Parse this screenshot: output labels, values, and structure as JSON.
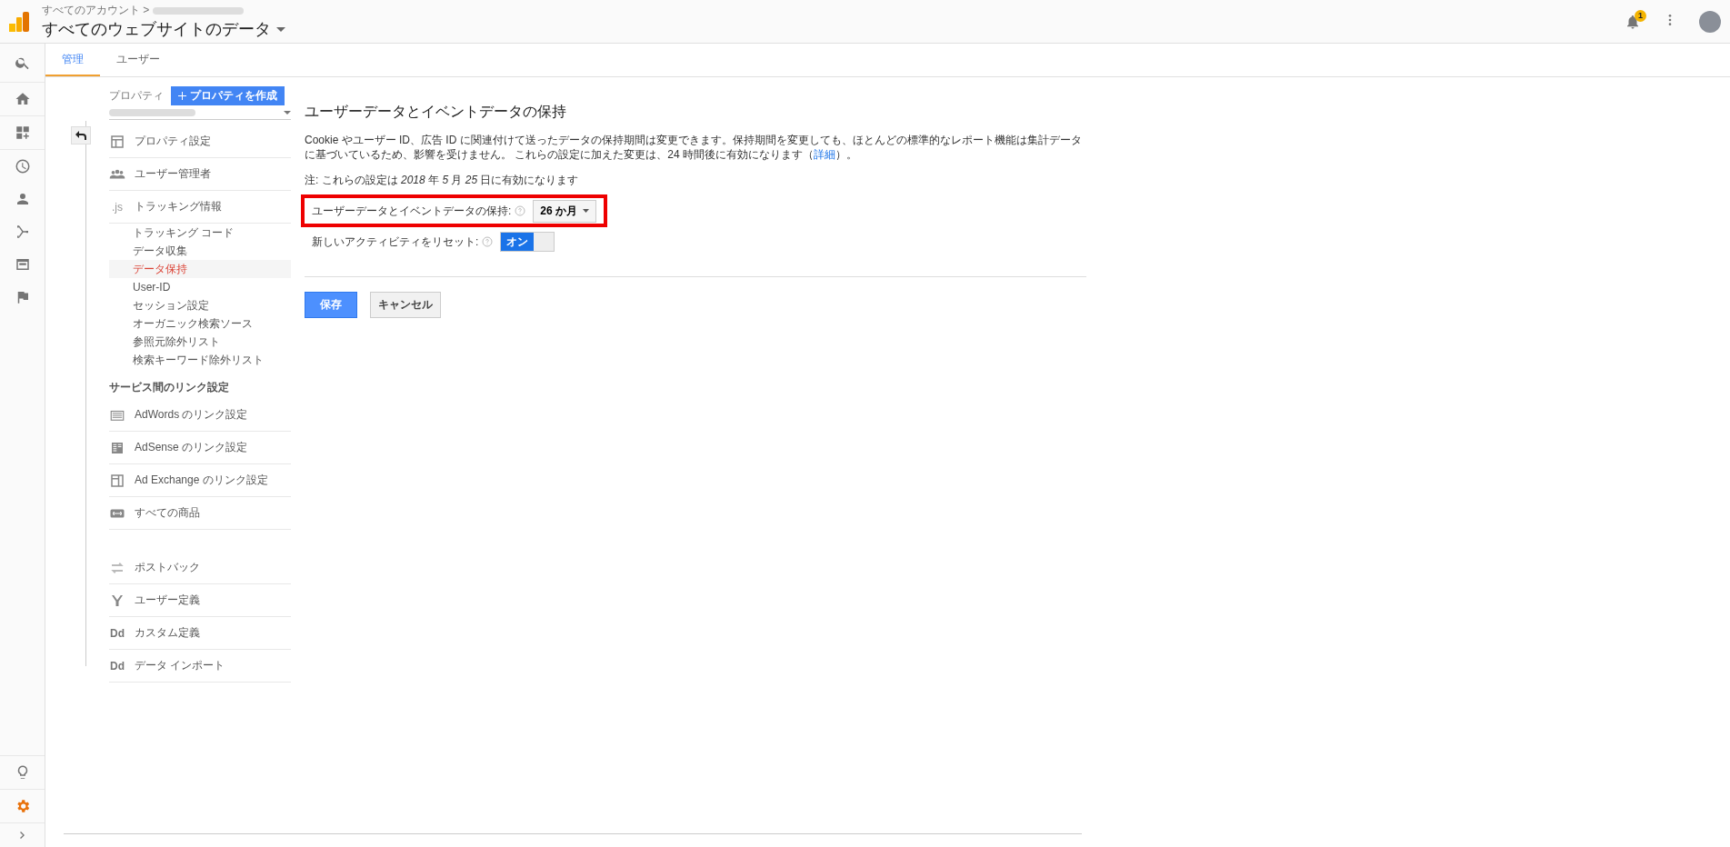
{
  "header": {
    "breadcrumb": "すべてのアカウント >",
    "title": "すべてのウェブサイトのデータ",
    "notification_count": "1"
  },
  "tabs": [
    {
      "label": "管理",
      "selected": true
    },
    {
      "label": "ユーザー",
      "selected": false
    }
  ],
  "property": {
    "label": "プロパティ",
    "create_button": "プロパティを作成"
  },
  "nav": [
    {
      "kind": "section",
      "label": "プロパティ設定"
    },
    {
      "kind": "section",
      "label": "ユーザー管理者"
    },
    {
      "kind": "section",
      "label": "トラッキング情報",
      "icon_text": ".js"
    },
    {
      "kind": "sub",
      "label": "トラッキング コード",
      "selected": false
    },
    {
      "kind": "sub",
      "label": "データ収集",
      "selected": false
    },
    {
      "kind": "sub",
      "label": "データ保持",
      "selected": true
    },
    {
      "kind": "sub",
      "label": "User-ID",
      "selected": false
    },
    {
      "kind": "sub",
      "label": "セッション設定",
      "selected": false
    },
    {
      "kind": "sub",
      "label": "オーガニック検索ソース",
      "selected": false
    },
    {
      "kind": "sub",
      "label": "参照元除外リスト",
      "selected": false
    },
    {
      "kind": "sub",
      "label": "検索キーワード除外リスト",
      "selected": false
    },
    {
      "kind": "heading",
      "label": "サービス間のリンク設定"
    },
    {
      "kind": "section",
      "label": "AdWords のリンク設定"
    },
    {
      "kind": "section",
      "label": "AdSense のリンク設定"
    },
    {
      "kind": "section",
      "label": "Ad Exchange のリンク設定"
    },
    {
      "kind": "section",
      "label": "すべての商品"
    },
    {
      "kind": "spacer"
    },
    {
      "kind": "section",
      "label": "ポストバック"
    },
    {
      "kind": "section",
      "label": "ユーザー定義"
    },
    {
      "kind": "section",
      "label": "カスタム定義",
      "icon_text": "Dd"
    },
    {
      "kind": "section",
      "label": "データ インポート",
      "icon_text": "Dd"
    }
  ],
  "main": {
    "title": "ユーザーデータとイベントデータの保持",
    "description": "Cookie やユーザー ID、広告 ID に関連付けて送ったデータの保持期間は変更できます。保持期間を変更しても、ほとんどの標準的なレポート機能は集計データに基づいているため、影響を受けません。 これらの設定に加えた変更は、24 時間後に有効になります（",
    "description_link": "詳細",
    "description_end": "）。",
    "note": "注: これらの設定は *2018* 年 *5* 月 *25* 日に有効になります",
    "retention": {
      "label": "ユーザーデータとイベントデータの保持:",
      "value": "26 か月",
      "highlighted": true
    },
    "reset": {
      "label": "新しいアクティビティをリセット:",
      "toggle_label": "オン",
      "on": true
    },
    "buttons": [
      {
        "kind": "primary",
        "label": "保存"
      },
      {
        "kind": "secondary",
        "label": "キャンセル"
      }
    ]
  }
}
